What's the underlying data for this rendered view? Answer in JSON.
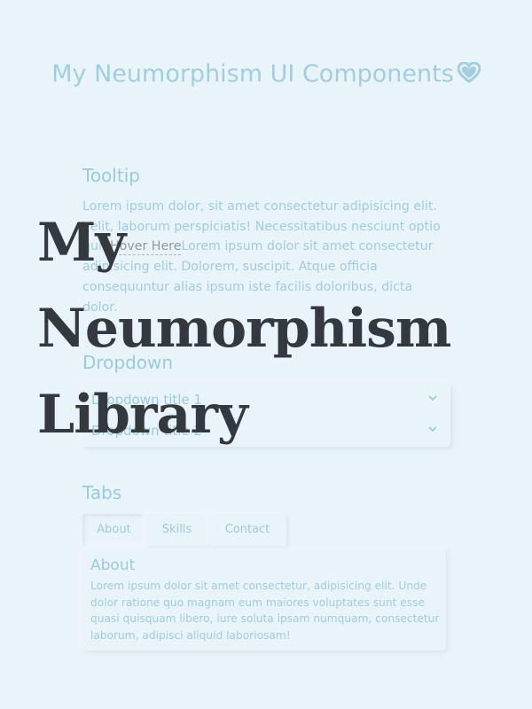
{
  "page": {
    "title": "My Neumorphism UI Components"
  },
  "tooltip_section": {
    "heading": "Tooltip",
    "text_before": "Lorem ipsum dolor, sit amet consectetur adipisicing elit. Velit, laborum perspiciatis! Necessitatibus nesciunt optio qui.",
    "trigger_label": "Hover Here",
    "text_after": "Lorem ipsum dolor sit amet consectetur adipisicing elit. Dolorem, suscipit. Atque officia consequuntur alias ipsum iste facilis doloribus, dicta dolor."
  },
  "dropdown_section": {
    "heading": "Dropdown",
    "items": [
      {
        "label": "Dropdown title 1",
        "icon": "chevron-down-icon"
      },
      {
        "label": "Dropdown title 2",
        "icon": "chevron-down-icon"
      }
    ]
  },
  "tabs_section": {
    "heading": "Tabs",
    "tabs": [
      {
        "label": "About",
        "active": true
      },
      {
        "label": "Skills",
        "active": false
      },
      {
        "label": "Contact",
        "active": false
      }
    ],
    "panel": {
      "title": "About",
      "text": "Lorem ipsum dolor sit amet consectetur, adipisicing elit. Unde dolor ratione quo magnam eum maiores voluptates sunt esse quasi quisquam libero, iure soluta ipsam numquam, consectetur laborum, adipisci aliquid laboriosam!"
    }
  },
  "overlay": {
    "lines": [
      "My",
      "Neumorphism",
      "Library"
    ]
  },
  "colors": {
    "background": "#e9f3fa",
    "accent": "#4ea3bd",
    "overlay_text": "#33393f"
  }
}
